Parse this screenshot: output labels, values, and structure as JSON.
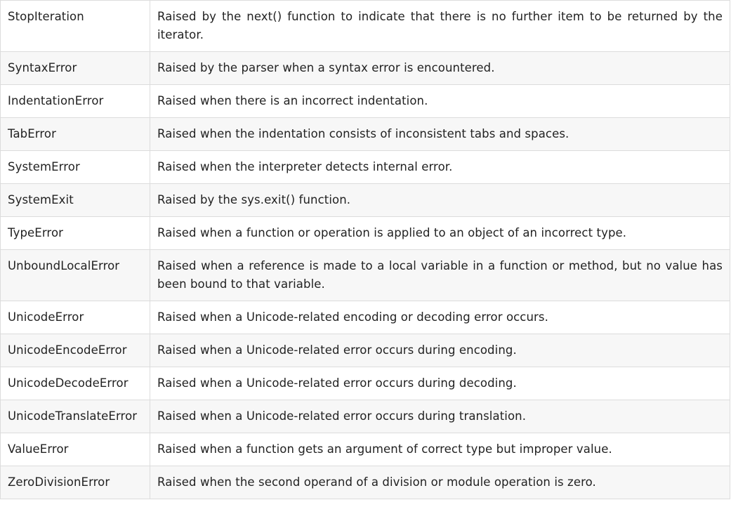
{
  "table": {
    "rows": [
      {
        "name": "StopIteration",
        "description": "Raised by the next() function to indicate that there is no further item to be returned by the iterator."
      },
      {
        "name": "SyntaxError",
        "description": "Raised by the parser when a syntax error is encountered."
      },
      {
        "name": "IndentationError",
        "description": "Raised when there is an incorrect indentation."
      },
      {
        "name": "TabError",
        "description": "Raised when the indentation consists of inconsistent tabs and spaces."
      },
      {
        "name": "SystemError",
        "description": "Raised when the interpreter detects internal error."
      },
      {
        "name": "SystemExit",
        "description": "Raised by the sys.exit() function."
      },
      {
        "name": "TypeError",
        "description": "Raised when a function or operation is applied to an object of an incorrect type."
      },
      {
        "name": "UnboundLocalError",
        "description": "Raised when a reference is made to a local variable in a function or method, but no value has been bound to that variable."
      },
      {
        "name": "UnicodeError",
        "description": "Raised when a Unicode-related encoding or decoding error occurs."
      },
      {
        "name": "UnicodeEncodeError",
        "description": "Raised when a Unicode-related error occurs during encoding."
      },
      {
        "name": "UnicodeDecodeError",
        "description": "Raised when a Unicode-related error occurs during decoding."
      },
      {
        "name": "UnicodeTranslateError",
        "description": "Raised when a Unicode-related error occurs during translation."
      },
      {
        "name": "ValueError",
        "description": "Raised when a function gets an argument of correct type but improper value."
      },
      {
        "name": "ZeroDivisionError",
        "description": "Raised when the second operand of a division or module operation is zero."
      }
    ]
  }
}
